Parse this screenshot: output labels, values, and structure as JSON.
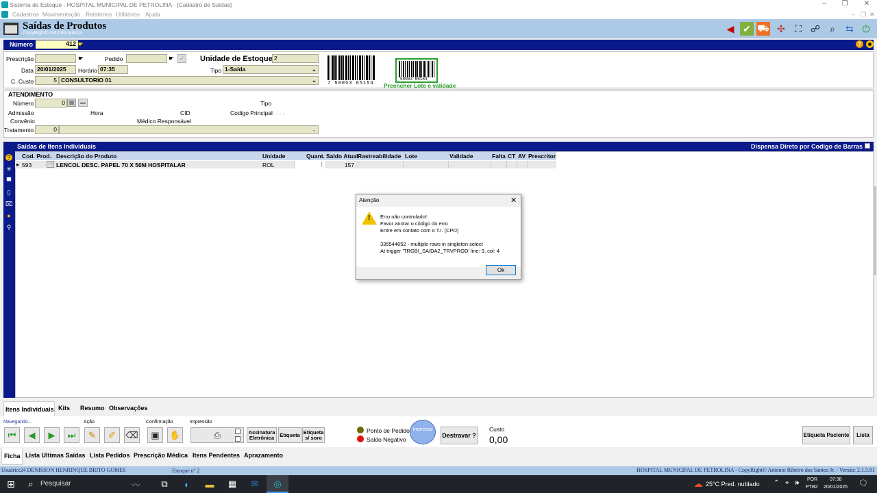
{
  "window": {
    "title": "Sistema de Estoque - HOSPITAL MUNICIPAL DE PETROLINA - [Cadastro de Saídas]",
    "controls": [
      "–",
      "❐",
      "✕"
    ],
    "mdi_controls": [
      "–",
      "❐",
      "✕"
    ]
  },
  "menu": [
    "Cadastros",
    "Movimentação",
    "Relatórios",
    "Utilitários",
    "Ajuda"
  ],
  "header": {
    "title": "Saídas de Produtos",
    "subtitle": "CopyRight© GA Informática"
  },
  "numero": {
    "label": "Número",
    "value": "412"
  },
  "form": {
    "prescricao_label": "Prescrição",
    "prescricao_value": "",
    "pedido_label": "Pedido",
    "pedido_value": "",
    "unidade_label": "Unidade de Estoque",
    "unidade_value": "2",
    "data_label": "Data",
    "data_value": "20/01/2025",
    "horario_label": "Horário",
    "horario_value": "07:35",
    "tipo_label": "Tipo",
    "tipo_value": "1-Saída",
    "custo_label": "C. Custo",
    "custo_code": "5",
    "custo_value": "CONSULTORIO 01",
    "barcode_text": "7 58053 65154",
    "barcode_text2": "58053 65154",
    "preencher_label": "Preencher Lote e validade"
  },
  "atendimento": {
    "title": "ATENDIMENTO",
    "numero_label": "Número",
    "numero_value": "0",
    "tipo_label": "Tipo",
    "admissao_label": "Admissão",
    "hora_label": "Hora",
    "cid_label": "CID",
    "codigo_principal_label": "Codigo Principal",
    "codigo_principal_value": ". . .",
    "convenio_label": "Convênio",
    "medico_label": "Médico Responsável",
    "tratamento_label": "Tratamento",
    "tratamento_value": "0"
  },
  "items": {
    "section_title": "Saídas de Itens Individuais",
    "dispensa_label": "Dispensa Direto por Codigo de Barras",
    "columns": [
      "Cod. Prod.",
      "Descrição do Produto",
      "Unidade",
      "Quant.",
      "Saldo Atual",
      "Rastreabilidade",
      "Lote",
      "Validade",
      "Falta",
      "CT",
      "AV",
      "Prescritor"
    ],
    "rows": [
      {
        "marker": "▸",
        "cod": "593",
        "desc": "LENCOL DESC. PAPEL 70 X 50M HOSPITALAR",
        "unidade": "ROL",
        "quant": "1",
        "saldo": "157",
        "rastreabilidade": "",
        "lote": "",
        "validade": "",
        "falta": "",
        "ct": "",
        "av": "",
        "prescritor": ""
      }
    ],
    "ellipsis": "···"
  },
  "dialog": {
    "title": "Atenção",
    "lines": [
      "Erro não controlado!",
      "Favor anotar o código do erro",
      "Entre em contato com o T.I. (CPD)",
      "",
      "335544652 - multiple rows in singleton select",
      "At trigger 'TRGBI_SAIDA2_TRVPROD' line: 9, col: 4"
    ],
    "ok_label": "Ok"
  },
  "bottom_tabs": [
    "Itens Individuais",
    "Kits",
    "Resumo",
    "Observações"
  ],
  "toolbar": {
    "navegando_label": "Navegando...",
    "acao_label": "Ação",
    "confirmacao_label": "Confirmação",
    "impressao_label": "Impressão",
    "assinatura_label": "Assinatura Eletrônica",
    "etiqueta_label": "Etiqueta",
    "etiqueta_soro_label": "Etiqueta s/ soro",
    "ponto_pedido_label": "Ponto de Pedido",
    "saldo_negativo_label": "Saldo Negativo",
    "impresso_label": "Impresso",
    "destravar_label": "Destravar ?",
    "custo_label": "Custo",
    "custo_value": "0,00",
    "etiqueta_paciente_label": "Etiqueta Paciente",
    "lista_label": "Lista"
  },
  "lower_tabs": [
    "Ficha",
    "Lista Ultimas Saídas",
    "Lista Pedidos",
    "Prescrição Médica",
    "Itens Pendentes",
    "Aprazamento"
  ],
  "statusbar": {
    "user": "Usuário:24 DENISSON HENRINQUE BRITO GOMES",
    "estoque": "Estoque nº 2",
    "copyright": "HOSPITAL MUNICIPAL DE PETROLINA - CopyRight© Antonio Ribeiro dos Santos Jr. - Versão: 2.1.5.91"
  },
  "taskbar": {
    "search_placeholder": "Pesquisar",
    "weather": "25°C  Pred. nublado",
    "lang1": "POR",
    "lang2": "PTB2",
    "time": "07:38",
    "date": "20/01/2025"
  },
  "colors": {
    "header_bg": "#acc9e6",
    "navy": "#0a1a8a",
    "field_bg": "#e6e6c8",
    "ponto_pedido": "#6b6b00",
    "saldo_negativo": "#e01010",
    "impresso": "#8fb2ea"
  }
}
